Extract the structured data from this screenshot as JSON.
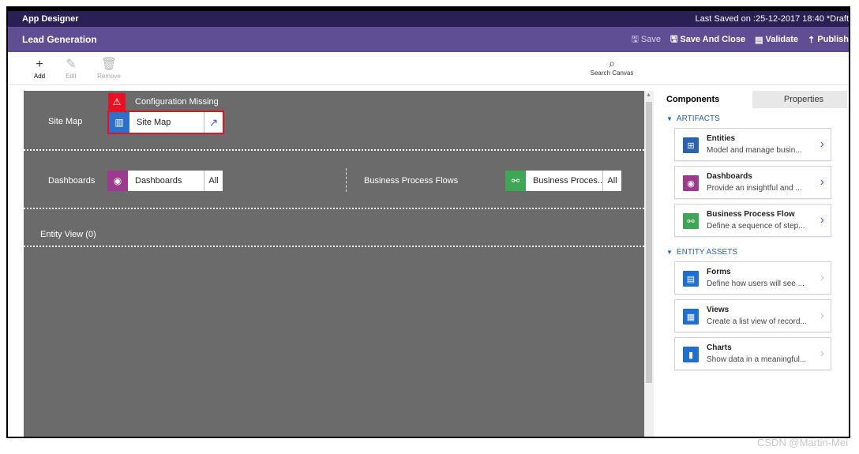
{
  "topbar": {
    "title": "App Designer",
    "saved": "Last Saved on :25-12-2017 18:40 *Draft"
  },
  "appbar": {
    "name": "Lead Generation",
    "actions": {
      "save": "Save",
      "save_close": "Save And Close",
      "validate": "Validate",
      "publish": "Publish"
    }
  },
  "toolbar": {
    "add": "Add",
    "edit": "Edit",
    "remove": "Remove",
    "search": "Search Canvas"
  },
  "canvas": {
    "sitemap_label": "Site Map",
    "warning": "Configuration Missing",
    "sitemap_tile": "Site Map",
    "dashboards_label": "Dashboards",
    "dashboards_tile": "Dashboards",
    "dashboards_all": "All",
    "bpf_label": "Business Process Flows",
    "bpf_tile": "Business Proces...",
    "bpf_all": "All",
    "entity_view": "Entity View (0)"
  },
  "panel": {
    "tabs": {
      "components": "Components",
      "properties": "Properties"
    },
    "artifacts_header": "ARTIFACTS",
    "artifacts": [
      {
        "title": "Entities",
        "desc": "Model and manage busin...",
        "color": "#2a62b0"
      },
      {
        "title": "Dashboards",
        "desc": "Provide an insightful and ...",
        "color": "#9b3a8f"
      },
      {
        "title": "Business Process Flow",
        "desc": "Define a sequence of step...",
        "color": "#3fa655"
      }
    ],
    "entity_assets_header": "ENTITY ASSETS",
    "entity_assets": [
      {
        "title": "Forms",
        "desc": "Define how users will see ...",
        "color": "#1e6fd0"
      },
      {
        "title": "Views",
        "desc": "Create a list view of record...",
        "color": "#1e6fd0"
      },
      {
        "title": "Charts",
        "desc": "Show data in a meaningful...",
        "color": "#1e6fd0"
      }
    ]
  },
  "watermark": "CSDN @Martin-Mei"
}
